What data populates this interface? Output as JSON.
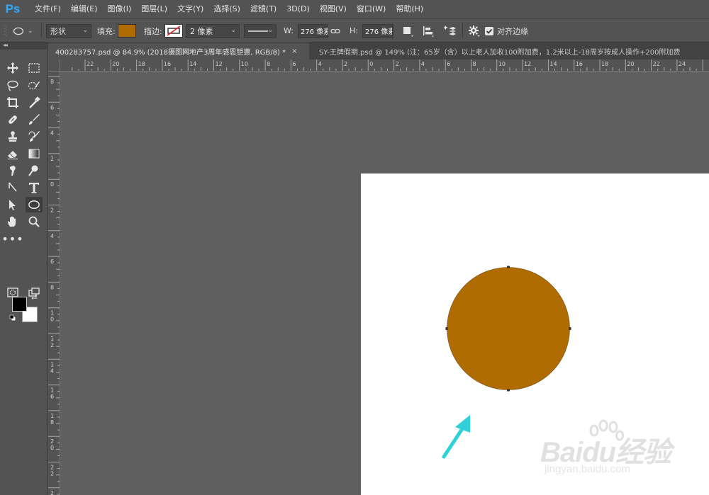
{
  "app": {
    "logo": "Ps",
    "menu": [
      "文件(F)",
      "编辑(E)",
      "图像(I)",
      "图层(L)",
      "文字(Y)",
      "选择(S)",
      "滤镜(T)",
      "3D(D)",
      "视图(V)",
      "窗口(W)",
      "帮助(H)"
    ]
  },
  "options": {
    "tool_icon": "ellipse-tool-icon",
    "mode": "形状",
    "fill_label": "填充:",
    "fill_color": "#b06c00",
    "stroke_label": "描边:",
    "stroke_width": "2 像素",
    "width_label": "W:",
    "width_value": "276 像素",
    "height_label": "H:",
    "height_value": "276 像素",
    "align_edges_label": "对齐边缘",
    "align_edges_checked": true
  },
  "tabs": [
    {
      "title": "400283757.psd @ 84.9% (2018摄图网地产3周年感恩钜惠, RGB/8) *",
      "close": "×"
    },
    {
      "title": "SY-王牌假期.psd @ 149% (注：65岁（含）以上老人加收100附加费，1.2米以上-18周岁按成人操作+200附加费"
    }
  ],
  "ruler": {
    "h_labels": [
      "22",
      "20",
      "18",
      "16",
      "14",
      "12",
      "10",
      "8",
      "6",
      "4",
      "2",
      "0",
      "2",
      "4",
      "6",
      "8",
      "10",
      "12",
      "14",
      "16",
      "18",
      "20",
      "22",
      "24"
    ],
    "v_labels": [
      "8",
      "6",
      "4",
      "2",
      "0",
      "2",
      "4",
      "6",
      "8",
      "1\n0",
      "1\n2",
      "1\n4",
      "1\n6",
      "1\n8",
      "2\n0",
      "2\n2",
      "2\n4"
    ]
  },
  "canvas": {
    "background": "#5f5f5f",
    "document_color": "#ffffff",
    "circle_fill": "#b06c00",
    "arrow_color": "#2fd0d8"
  },
  "watermark": {
    "brand": "Baidu经验",
    "site": "jingyan.baidu.com"
  }
}
